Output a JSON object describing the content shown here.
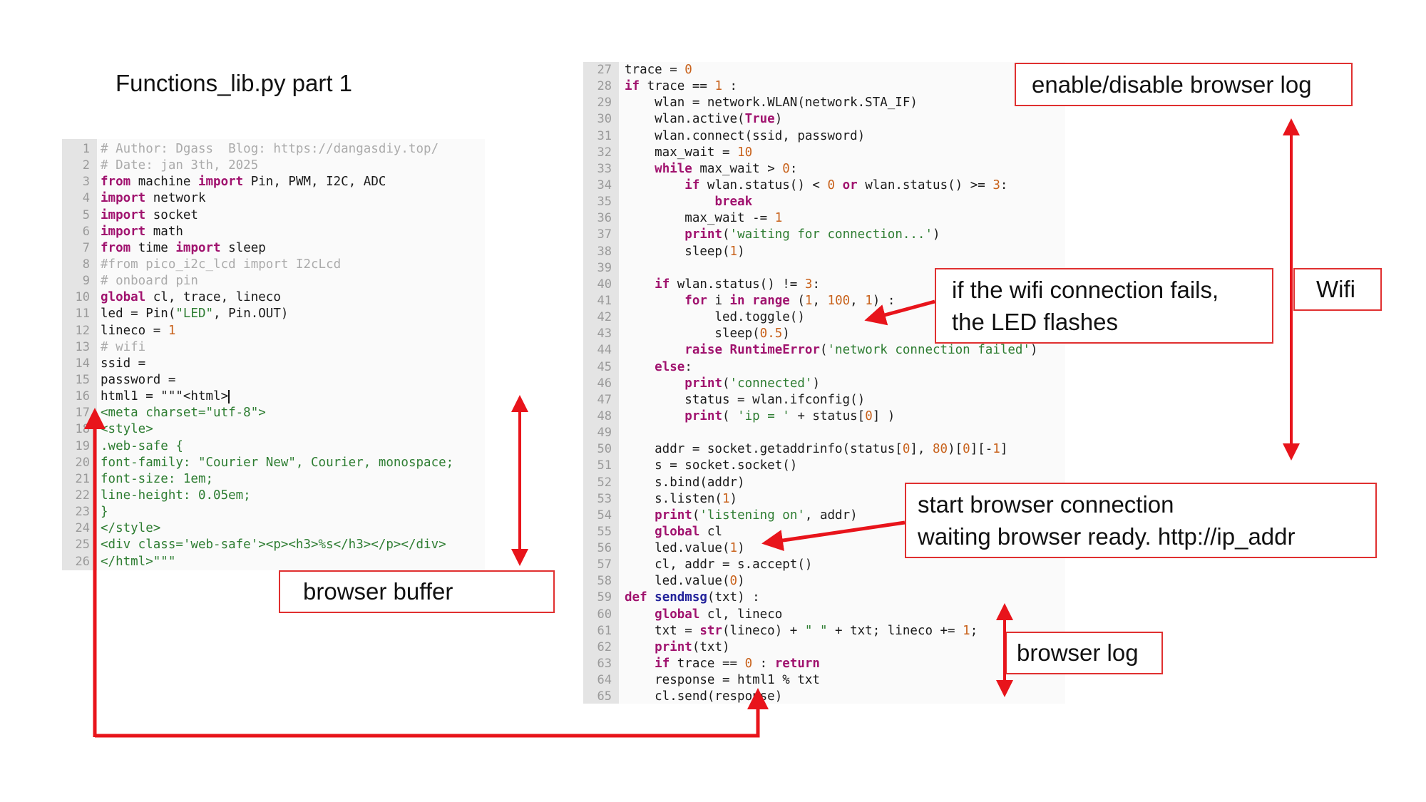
{
  "title": "Functions_lib.py part 1",
  "colors": {
    "keyword": "#a0126e",
    "string": "#2e7d32",
    "number": "#c8621c",
    "comment": "#ababab",
    "function": "#22229a",
    "annotation": "#e8141b"
  },
  "left_code": {
    "start": 1,
    "lines": [
      [
        [
          "c",
          "# Author: Dgass  Blog: https://dangasdiy.top/"
        ]
      ],
      [
        [
          "c",
          "# Date: jan 3th, 2025"
        ]
      ],
      [
        [
          "k",
          "from"
        ],
        [
          "p",
          " machine "
        ],
        [
          "k",
          "import"
        ],
        [
          "p",
          " Pin, PWM, I2C, ADC"
        ]
      ],
      [
        [
          "k",
          "import"
        ],
        [
          "p",
          " network"
        ]
      ],
      [
        [
          "k",
          "import"
        ],
        [
          "p",
          " socket"
        ]
      ],
      [
        [
          "k",
          "import"
        ],
        [
          "p",
          " math"
        ]
      ],
      [
        [
          "k",
          "from"
        ],
        [
          "p",
          " time "
        ],
        [
          "k",
          "import"
        ],
        [
          "p",
          " sleep"
        ]
      ],
      [
        [
          "c",
          "#from pico_i2c_lcd import I2cLcd"
        ]
      ],
      [
        [
          "c",
          "# onboard pin"
        ]
      ],
      [
        [
          "k",
          "global"
        ],
        [
          "p",
          " cl, trace, lineco"
        ]
      ],
      [
        [
          "p",
          "led = Pin("
        ],
        [
          "s",
          "\"LED\""
        ],
        [
          "p",
          ", Pin.OUT)"
        ]
      ],
      [
        [
          "p",
          "lineco = "
        ],
        [
          "n",
          "1"
        ]
      ],
      [
        [
          "c",
          "# wifi"
        ]
      ],
      [
        [
          "p",
          "ssid ="
        ]
      ],
      [
        [
          "p",
          "password ="
        ]
      ],
      [
        [
          "p",
          "html1 = \"\"\"<html>"
        ]
      ],
      [
        [
          "s",
          "<meta charset=\"utf-8\">"
        ]
      ],
      [
        [
          "s",
          "<style>"
        ]
      ],
      [
        [
          "s",
          ".web-safe {"
        ]
      ],
      [
        [
          "s",
          "font-family: \"Courier New\", Courier, monospace;"
        ]
      ],
      [
        [
          "s",
          "font-size: 1em;"
        ]
      ],
      [
        [
          "s",
          "line-height: 0.05em;"
        ]
      ],
      [
        [
          "s",
          "}"
        ]
      ],
      [
        [
          "s",
          "</style>"
        ]
      ],
      [
        [
          "s",
          "<div class='web-safe'><p><h3>%s</h3></p></div>"
        ]
      ],
      [
        [
          "s",
          "</html>\"\"\""
        ]
      ]
    ]
  },
  "right_code": {
    "start": 27,
    "lines": [
      [
        [
          "p",
          "trace = "
        ],
        [
          "n",
          "0"
        ]
      ],
      [
        [
          "k",
          "if"
        ],
        [
          "p",
          " trace == "
        ],
        [
          "n",
          "1"
        ],
        [
          "p",
          " :"
        ]
      ],
      [
        [
          "p",
          "    wlan = network.WLAN(network.STA_IF)"
        ]
      ],
      [
        [
          "p",
          "    wlan.active("
        ],
        [
          "k",
          "True"
        ],
        [
          "p",
          ")"
        ]
      ],
      [
        [
          "p",
          "    wlan.connect(ssid, password)"
        ]
      ],
      [
        [
          "p",
          "    max_wait = "
        ],
        [
          "n",
          "10"
        ]
      ],
      [
        [
          "p",
          "    "
        ],
        [
          "k",
          "while"
        ],
        [
          "p",
          " max_wait > "
        ],
        [
          "n",
          "0"
        ],
        [
          "p",
          ":"
        ]
      ],
      [
        [
          "p",
          "        "
        ],
        [
          "k",
          "if"
        ],
        [
          "p",
          " wlan.status() < "
        ],
        [
          "n",
          "0"
        ],
        [
          "p",
          " "
        ],
        [
          "k",
          "or"
        ],
        [
          "p",
          " wlan.status() >= "
        ],
        [
          "n",
          "3"
        ],
        [
          "p",
          ":"
        ]
      ],
      [
        [
          "p",
          "            "
        ],
        [
          "k",
          "break"
        ]
      ],
      [
        [
          "p",
          "        max_wait -= "
        ],
        [
          "n",
          "1"
        ]
      ],
      [
        [
          "p",
          "        "
        ],
        [
          "k",
          "print"
        ],
        [
          "p",
          "("
        ],
        [
          "s",
          "'waiting for connection...'"
        ],
        [
          "p",
          ")"
        ]
      ],
      [
        [
          "p",
          "        sleep("
        ],
        [
          "n",
          "1"
        ],
        [
          "p",
          ")"
        ]
      ],
      [
        [
          "p",
          ""
        ]
      ],
      [
        [
          "p",
          "    "
        ],
        [
          "k",
          "if"
        ],
        [
          "p",
          " wlan.status() != "
        ],
        [
          "n",
          "3"
        ],
        [
          "p",
          ":"
        ]
      ],
      [
        [
          "p",
          "        "
        ],
        [
          "k",
          "for"
        ],
        [
          "p",
          " i "
        ],
        [
          "k",
          "in"
        ],
        [
          "p",
          " "
        ],
        [
          "k",
          "range"
        ],
        [
          "p",
          " ("
        ],
        [
          "n",
          "1"
        ],
        [
          "p",
          ", "
        ],
        [
          "n",
          "100"
        ],
        [
          "p",
          ", "
        ],
        [
          "n",
          "1"
        ],
        [
          "p",
          ") :"
        ]
      ],
      [
        [
          "p",
          "            led.toggle()"
        ]
      ],
      [
        [
          "p",
          "            sleep("
        ],
        [
          "n",
          "0.5"
        ],
        [
          "p",
          ")"
        ]
      ],
      [
        [
          "p",
          "        "
        ],
        [
          "k",
          "raise"
        ],
        [
          "p",
          " "
        ],
        [
          "k",
          "RuntimeError"
        ],
        [
          "p",
          "("
        ],
        [
          "s",
          "'network connection failed'"
        ],
        [
          "p",
          ")"
        ]
      ],
      [
        [
          "p",
          "    "
        ],
        [
          "k",
          "else"
        ],
        [
          "p",
          ":"
        ]
      ],
      [
        [
          "p",
          "        "
        ],
        [
          "k",
          "print"
        ],
        [
          "p",
          "("
        ],
        [
          "s",
          "'connected'"
        ],
        [
          "p",
          ")"
        ]
      ],
      [
        [
          "p",
          "        status = wlan.ifconfig()"
        ]
      ],
      [
        [
          "p",
          "        "
        ],
        [
          "k",
          "print"
        ],
        [
          "p",
          "( "
        ],
        [
          "s",
          "'ip = '"
        ],
        [
          "p",
          " + status["
        ],
        [
          "n",
          "0"
        ],
        [
          "p",
          "] )"
        ]
      ],
      [
        [
          "p",
          ""
        ]
      ],
      [
        [
          "p",
          "    addr = socket.getaddrinfo(status["
        ],
        [
          "n",
          "0"
        ],
        [
          "p",
          "], "
        ],
        [
          "n",
          "80"
        ],
        [
          "p",
          ")["
        ],
        [
          "n",
          "0"
        ],
        [
          "p",
          "][-"
        ],
        [
          "n",
          "1"
        ],
        [
          "p",
          "]"
        ]
      ],
      [
        [
          "p",
          "    s = socket.socket()"
        ]
      ],
      [
        [
          "p",
          "    s.bind(addr)"
        ]
      ],
      [
        [
          "p",
          "    s.listen("
        ],
        [
          "n",
          "1"
        ],
        [
          "p",
          ")"
        ]
      ],
      [
        [
          "p",
          "    "
        ],
        [
          "k",
          "print"
        ],
        [
          "p",
          "("
        ],
        [
          "s",
          "'listening on'"
        ],
        [
          "p",
          ", addr)"
        ]
      ],
      [
        [
          "p",
          "    "
        ],
        [
          "k",
          "global"
        ],
        [
          "p",
          " cl"
        ]
      ],
      [
        [
          "p",
          "    led.value("
        ],
        [
          "n",
          "1"
        ],
        [
          "p",
          ")"
        ]
      ],
      [
        [
          "p",
          "    cl, addr = s.accept()"
        ]
      ],
      [
        [
          "p",
          "    led.value("
        ],
        [
          "n",
          "0"
        ],
        [
          "p",
          ")"
        ]
      ],
      [
        [
          "k",
          "def"
        ],
        [
          "p",
          " "
        ],
        [
          "f",
          "sendmsg"
        ],
        [
          "p",
          "(txt) :"
        ]
      ],
      [
        [
          "p",
          "    "
        ],
        [
          "k",
          "global"
        ],
        [
          "p",
          " cl, lineco"
        ]
      ],
      [
        [
          "p",
          "    txt = "
        ],
        [
          "k",
          "str"
        ],
        [
          "p",
          "(lineco) + "
        ],
        [
          "s",
          "\" \""
        ],
        [
          "p",
          " + txt; lineco += "
        ],
        [
          "n",
          "1"
        ],
        [
          "p",
          ";"
        ]
      ],
      [
        [
          "p",
          "    "
        ],
        [
          "k",
          "print"
        ],
        [
          "p",
          "(txt)"
        ]
      ],
      [
        [
          "p",
          "    "
        ],
        [
          "k",
          "if"
        ],
        [
          "p",
          " trace == "
        ],
        [
          "n",
          "0"
        ],
        [
          "p",
          " : "
        ],
        [
          "k",
          "return"
        ]
      ],
      [
        [
          "p",
          "    response = html1 % txt"
        ]
      ],
      [
        [
          "p",
          "    cl.send(response)"
        ]
      ]
    ]
  },
  "annotations": {
    "trace_toggle": "enable/disable browser log",
    "wifi_fail": [
      "if the wifi connection fails,",
      "the LED flashes"
    ],
    "wifi": "Wifi",
    "browser_connection": [
      "start browser connection",
      "waiting browser ready. http://ip_addr"
    ],
    "browser_buffer": "browser buffer",
    "browser_log": "browser log"
  }
}
